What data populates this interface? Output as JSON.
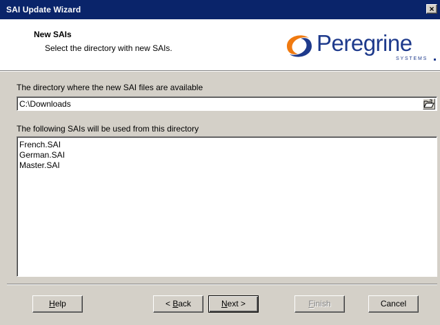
{
  "window": {
    "title": "SAI Update Wizard",
    "close_glyph": "×"
  },
  "header": {
    "title": "New SAIs",
    "subtitle": "Select the directory with new SAIs.",
    "logo_text": "Peregrine",
    "logo_subtext": "SYSTEMS"
  },
  "directory": {
    "label": "The directory where the new SAI files are available",
    "value": "C:\\Downloads"
  },
  "sai_list": {
    "label": "The following SAIs will be used from this directory",
    "items": [
      "French.SAI",
      "German.SAI",
      "Master.SAI"
    ]
  },
  "buttons": {
    "help": {
      "accel": "H",
      "rest": "elp"
    },
    "back": {
      "prefix": "< ",
      "accel": "B",
      "rest": "ack"
    },
    "next": {
      "accel": "N",
      "rest": "ext >"
    },
    "finish": {
      "accel": "F",
      "rest": "inish"
    },
    "cancel": "Cancel"
  },
  "colors": {
    "titlebar": "#0a246a",
    "face": "#d4d0c8",
    "logo": "#1e3a8c",
    "logo_swirl_orange": "#f07a10",
    "logo_swirl_blue": "#1e3a8c"
  },
  "icons": {
    "browse": "folder-open-icon",
    "logo": "peregrine-swirl-icon"
  }
}
